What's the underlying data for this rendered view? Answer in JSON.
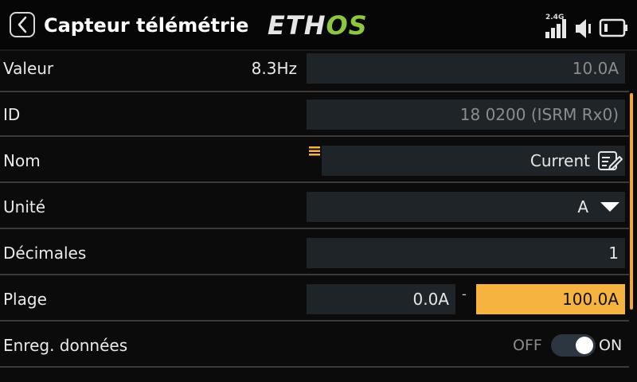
{
  "header": {
    "title": "Capteur télémétrie",
    "logo_part1": "ETH",
    "logo_part2": "OS",
    "signal_band": "2.4G",
    "logo_colors": {
      "primary": "#e6e6e6",
      "accent": "#8dc63f"
    }
  },
  "rows": {
    "valeur": {
      "label": "Valeur",
      "rate": "8.3Hz",
      "value": "10.0A"
    },
    "id": {
      "label": "ID",
      "value": "18 0200 (ISRM Rx0)"
    },
    "nom": {
      "label": "Nom",
      "value": "Current"
    },
    "unite": {
      "label": "Unité",
      "value": "A"
    },
    "decimales": {
      "label": "Décimales",
      "value": "1"
    },
    "plage": {
      "label": "Plage",
      "min": "0.0A",
      "separator": "-",
      "max": "100.0A"
    },
    "enreg": {
      "label": "Enreg. données",
      "off_label": "OFF",
      "on_label": "ON",
      "state": "on"
    }
  },
  "icons": [
    "back-chevron-icon",
    "signal-bars-icon",
    "speaker-icon",
    "battery-icon",
    "menu-lines-icon",
    "edit-icon",
    "dropdown-triangle-icon"
  ],
  "colors": {
    "accent": "#f7b340",
    "field_bg": "#1e2428",
    "background": "#0b0b0b"
  }
}
